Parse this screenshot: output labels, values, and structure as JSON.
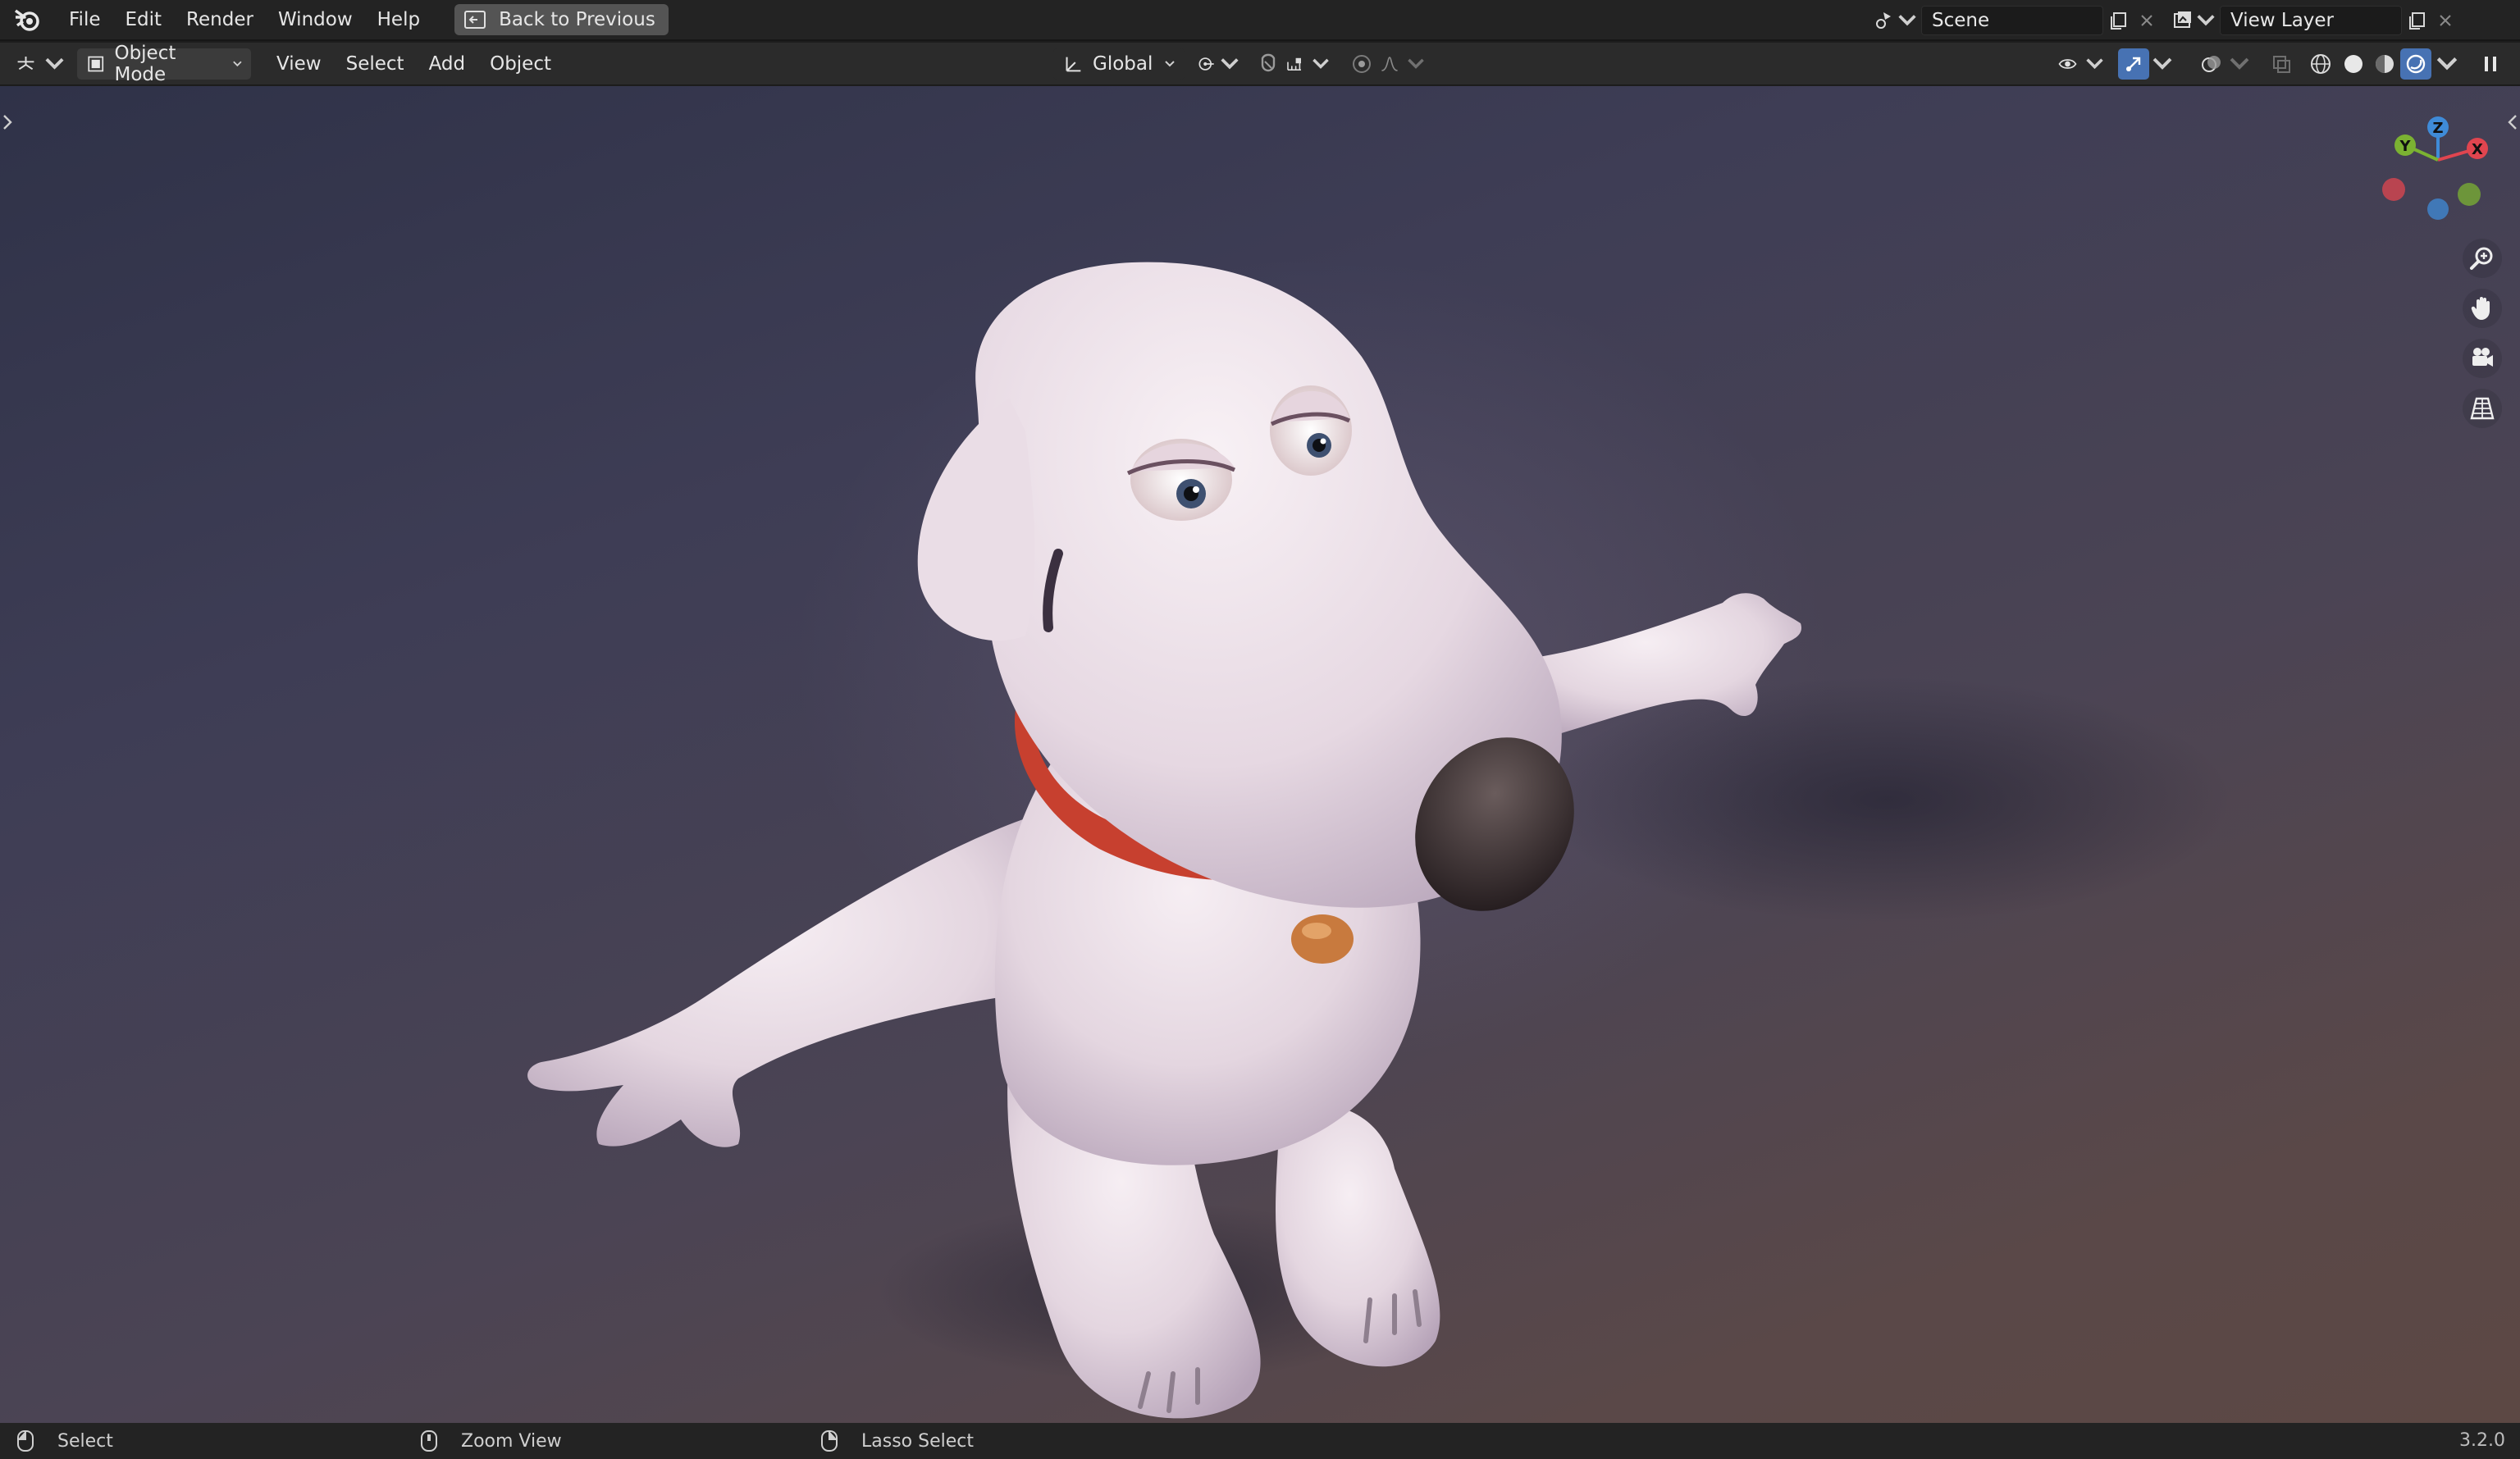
{
  "menubar": {
    "items": [
      "File",
      "Edit",
      "Render",
      "Window",
      "Help"
    ],
    "back_button": "Back to Previous",
    "scene_label": "Scene",
    "view_layer_label": "View Layer"
  },
  "header": {
    "mode": "Object Mode",
    "menus": [
      "View",
      "Select",
      "Add",
      "Object"
    ],
    "transform_orientation": "Global"
  },
  "gizmo": {
    "axes": [
      "X",
      "Y",
      "Z"
    ],
    "colors": {
      "x": "#e0454f",
      "y": "#7bb232",
      "z": "#3f8bd8"
    }
  },
  "statusbar": {
    "items": [
      "Select",
      "Zoom View",
      "Lasso Select"
    ],
    "version": "3.2.0"
  },
  "icons": {
    "app": "blender-logo",
    "viewport_tools": [
      "zoom-icon",
      "hand-pan-icon",
      "camera-icon",
      "grid-perspective-icon"
    ]
  }
}
